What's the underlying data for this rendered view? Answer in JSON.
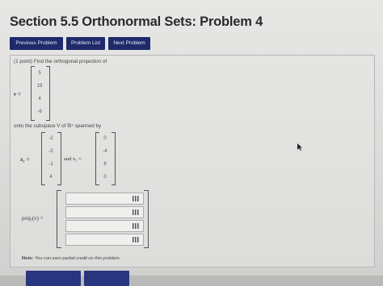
{
  "title": "Section 5.5 Orthonormal Sets: Problem 4",
  "nav": {
    "previous": "Previous Problem",
    "list": "Problem List",
    "next": "Next Problem"
  },
  "problem": {
    "prompt": "(1 point) Find the orthogonal projection of",
    "v_label": "v =",
    "v": [
      "5",
      "19",
      "4",
      "-6"
    ],
    "subspace_text": "onto the subspace V of ℝ⁴ spanned by",
    "x1_label": "x₁ =",
    "x1": [
      "-2",
      "-2",
      "-1",
      "4"
    ],
    "and_text": "and x₂ =",
    "x2": [
      "0",
      "-4",
      "8",
      "0"
    ],
    "proj_label": "projᵥ(v) =",
    "answers": [
      "",
      "",
      "",
      ""
    ]
  },
  "note": {
    "label": "Note:",
    "text": "You can earn partial credit on this problem."
  },
  "colors": {
    "nav_bg": "#1f2a6b",
    "nav_text": "#e8eaf5"
  }
}
